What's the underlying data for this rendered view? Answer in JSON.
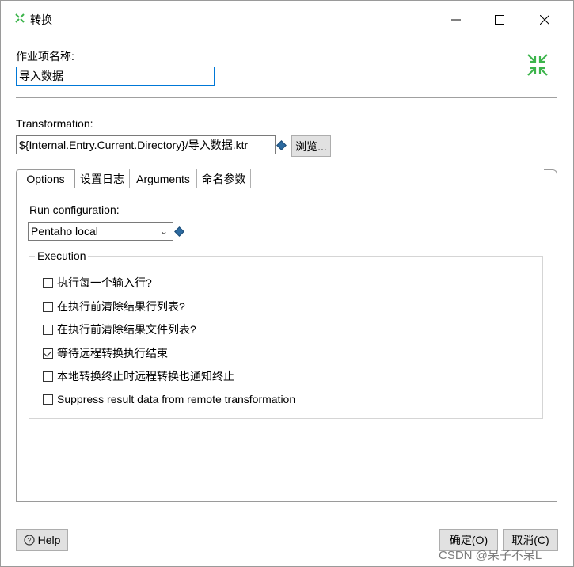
{
  "window": {
    "title": "转换",
    "controls": {
      "minimize": "—",
      "maximize": "☐",
      "close": "✕"
    }
  },
  "job_entry": {
    "name_label": "作业项名称:",
    "name_value": "导入数据"
  },
  "transformation": {
    "label": "Transformation:",
    "path_value": "${Internal.Entry.Current.Directory}/导入数据.ktr",
    "browse_label": "浏览..."
  },
  "tabs": [
    {
      "label": "Options",
      "active": true
    },
    {
      "label": "设置日志",
      "active": false
    },
    {
      "label": "Arguments",
      "active": false
    },
    {
      "label": "命名参数",
      "active": false
    }
  ],
  "options": {
    "run_config_label": "Run configuration:",
    "run_config_value": "Pentaho local",
    "execution_title": "Execution",
    "checkboxes": [
      {
        "label": "执行每一个输入行?",
        "checked": false
      },
      {
        "label": "在执行前清除结果行列表?",
        "checked": false
      },
      {
        "label": "在执行前清除结果文件列表?",
        "checked": false
      },
      {
        "label": "等待远程转换执行结束",
        "checked": true
      },
      {
        "label": "本地转换终止时远程转换也通知终止",
        "checked": false
      },
      {
        "label": "Suppress result data from remote transformation",
        "checked": false
      }
    ]
  },
  "footer": {
    "help_label": "Help",
    "ok_label": "确定(O)",
    "cancel_label": "取消(C)"
  },
  "watermark": "CSDN @呆子不呆L",
  "icons": {
    "app": "transformation-icon",
    "collapse": "collapse-arrows-icon",
    "variable": "variable-diamond-icon",
    "help": "help-circle-icon"
  },
  "colors": {
    "accent": "#0078d7",
    "icon_green": "#3cb44b",
    "diamond": "#2c6aa0"
  }
}
